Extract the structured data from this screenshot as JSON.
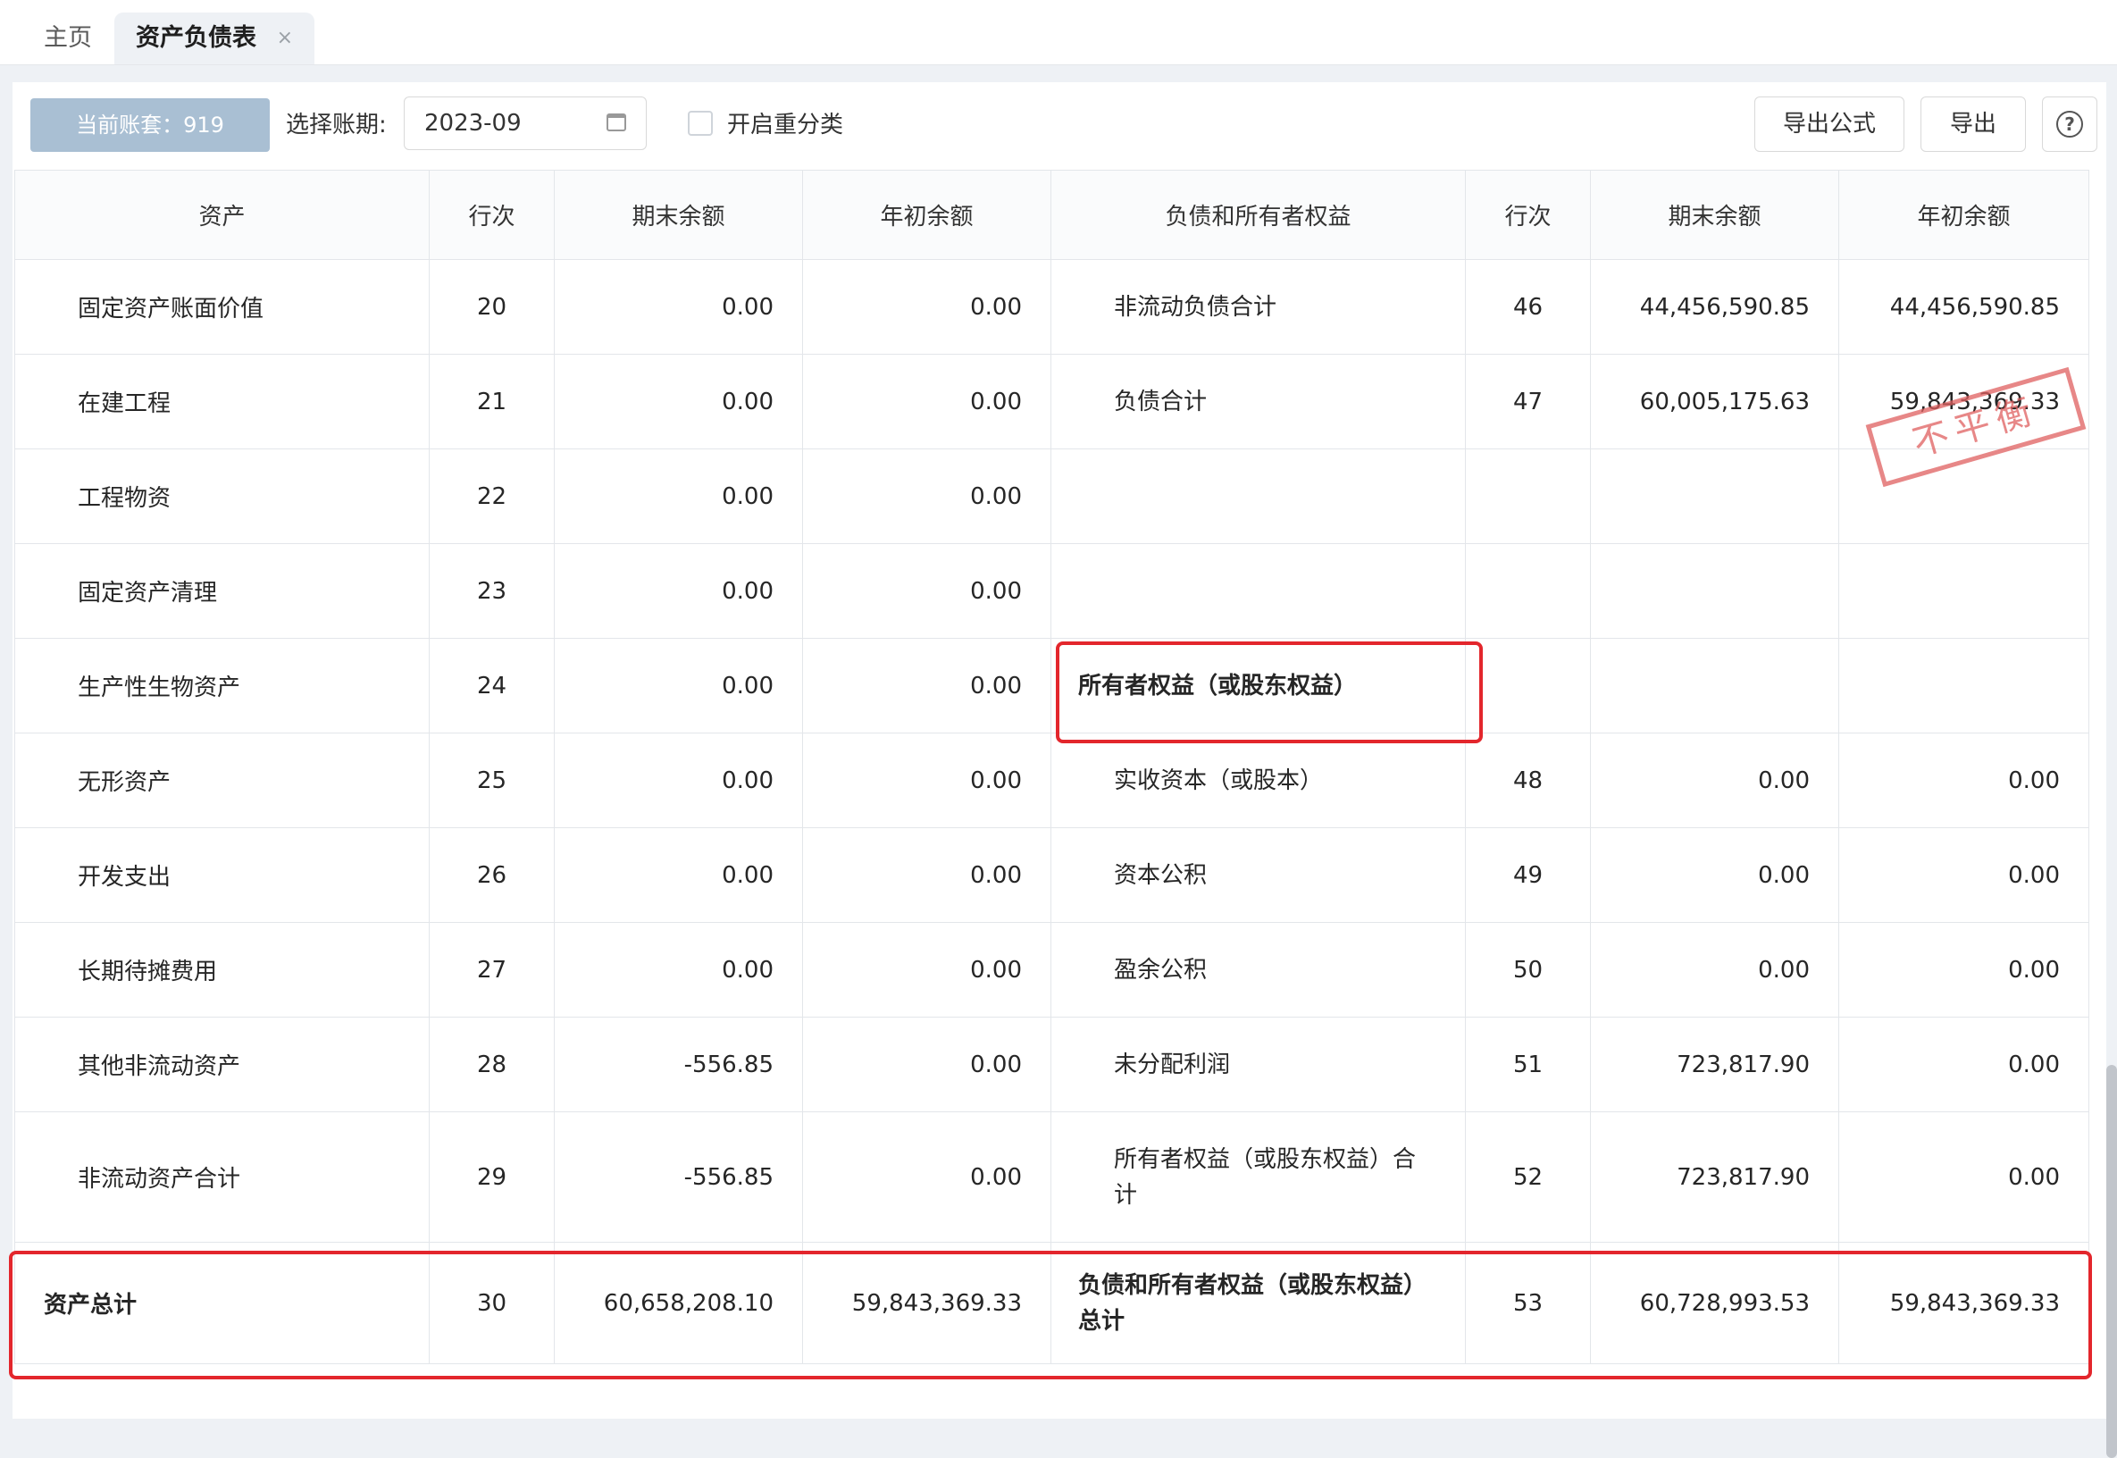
{
  "tabs": [
    {
      "label": "主页"
    },
    {
      "label": "资产负债表",
      "close": "×"
    }
  ],
  "toolbar": {
    "ledger_badge": "当前账套：919",
    "period_label": "选择账期:",
    "period_value": "2023-09",
    "reclassify_label": "开启重分类",
    "export_formula": "导出公式",
    "export": "导出",
    "help": "?"
  },
  "headers": [
    "资产",
    "行次",
    "期末余额",
    "年初余额",
    "负债和所有者权益",
    "行次",
    "期末余额",
    "年初余额"
  ],
  "rows": [
    {
      "a_name": "固定资产账面价值",
      "a_idx": "20",
      "a_end": "0.00",
      "a_begin": "0.00",
      "l_name": "非流动负债合计",
      "l_idx": "46",
      "l_end": "44,456,590.85",
      "l_begin": "44,456,590.85"
    },
    {
      "a_name": "在建工程",
      "a_idx": "21",
      "a_end": "0.00",
      "a_begin": "0.00",
      "l_name": "负债合计",
      "l_idx": "47",
      "l_end": "60,005,175.63",
      "l_begin": "59,843,369.33"
    },
    {
      "a_name": "工程物资",
      "a_idx": "22",
      "a_end": "0.00",
      "a_begin": "0.00",
      "l_name": "",
      "l_idx": "",
      "l_end": "",
      "l_begin": ""
    },
    {
      "a_name": "固定资产清理",
      "a_idx": "23",
      "a_end": "0.00",
      "a_begin": "0.00",
      "l_name": "",
      "l_idx": "",
      "l_end": "",
      "l_begin": ""
    },
    {
      "a_name": "生产性生物资产",
      "a_idx": "24",
      "a_end": "0.00",
      "a_begin": "0.00",
      "l_name": "所有者权益（或股东权益）",
      "l_idx": "",
      "l_end": "",
      "l_begin": ""
    },
    {
      "a_name": "无形资产",
      "a_idx": "25",
      "a_end": "0.00",
      "a_begin": "0.00",
      "l_name": "实收资本（或股本）",
      "l_idx": "48",
      "l_end": "0.00",
      "l_begin": "0.00"
    },
    {
      "a_name": "开发支出",
      "a_idx": "26",
      "a_end": "0.00",
      "a_begin": "0.00",
      "l_name": "资本公积",
      "l_idx": "49",
      "l_end": "0.00",
      "l_begin": "0.00"
    },
    {
      "a_name": "长期待摊费用",
      "a_idx": "27",
      "a_end": "0.00",
      "a_begin": "0.00",
      "l_name": "盈余公积",
      "l_idx": "50",
      "l_end": "0.00",
      "l_begin": "0.00"
    },
    {
      "a_name": "其他非流动资产",
      "a_idx": "28",
      "a_end": "-556.85",
      "a_begin": "0.00",
      "l_name": "未分配利润",
      "l_idx": "51",
      "l_end": "723,817.90",
      "l_begin": "0.00"
    },
    {
      "a_name": "非流动资产合计",
      "a_idx": "29",
      "a_end": "-556.85",
      "a_begin": "0.00",
      "l_name": "所有者权益（或股东权益）合计",
      "l_idx": "52",
      "l_end": "723,817.90",
      "l_begin": "0.00"
    }
  ],
  "total_row": {
    "a_name": "资产总计",
    "a_idx": "30",
    "a_end": "60,658,208.10",
    "a_begin": "59,843,369.33",
    "l_name": "负债和所有者权益（或股东权益）总计",
    "l_idx": "53",
    "l_end": "60,728,993.53",
    "l_begin": "59,843,369.33"
  },
  "stamp": "不平衡",
  "colors": {
    "highlight": "#e3262c",
    "stamp": "#e06060",
    "badge": "#a9bfd3"
  }
}
